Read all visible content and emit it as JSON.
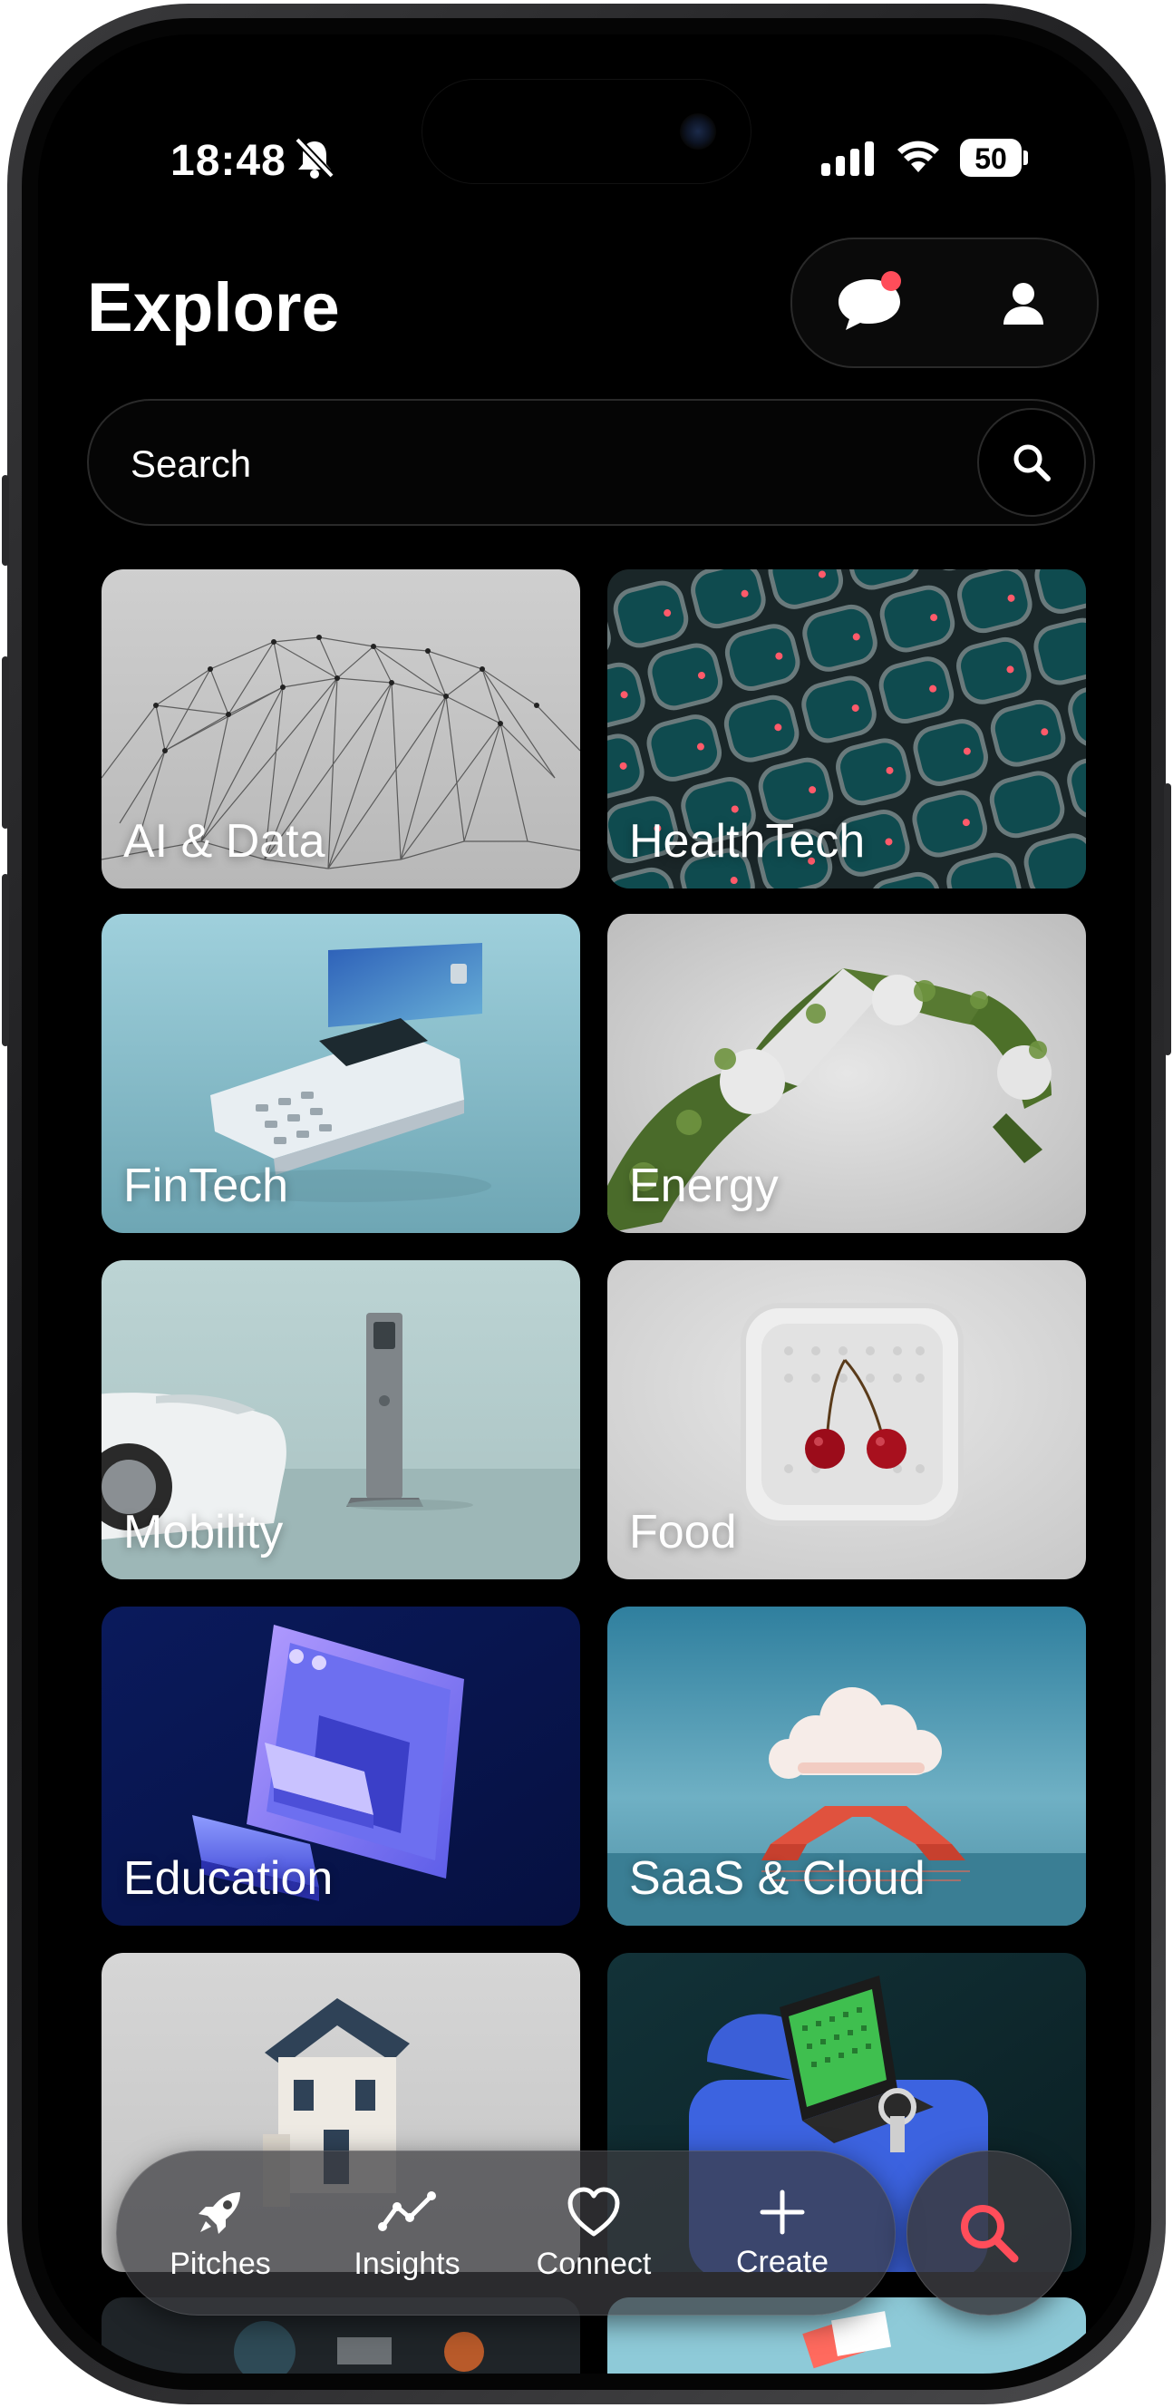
{
  "status_bar": {
    "time": "18:48",
    "battery": "50"
  },
  "header": {
    "title": "Explore"
  },
  "search": {
    "placeholder": "Search"
  },
  "categories": [
    {
      "label": "AI & Data"
    },
    {
      "label": "HealthTech"
    },
    {
      "label": "FinTech"
    },
    {
      "label": "Energy"
    },
    {
      "label": "Mobility"
    },
    {
      "label": "Food"
    },
    {
      "label": "Education"
    },
    {
      "label": "SaaS & Cloud"
    },
    {
      "label": ""
    },
    {
      "label": ""
    }
  ],
  "tab_bar": {
    "items": [
      {
        "label": "Pitches",
        "icon": "rocket-icon"
      },
      {
        "label": "Insights",
        "icon": "trend-line-icon"
      },
      {
        "label": "Connect",
        "icon": "heart-icon"
      },
      {
        "label": "Create",
        "icon": "plus-icon"
      }
    ]
  },
  "colors": {
    "notification_dot": "#ff4d5a",
    "search_fab_icon": "#ff4d5a"
  }
}
